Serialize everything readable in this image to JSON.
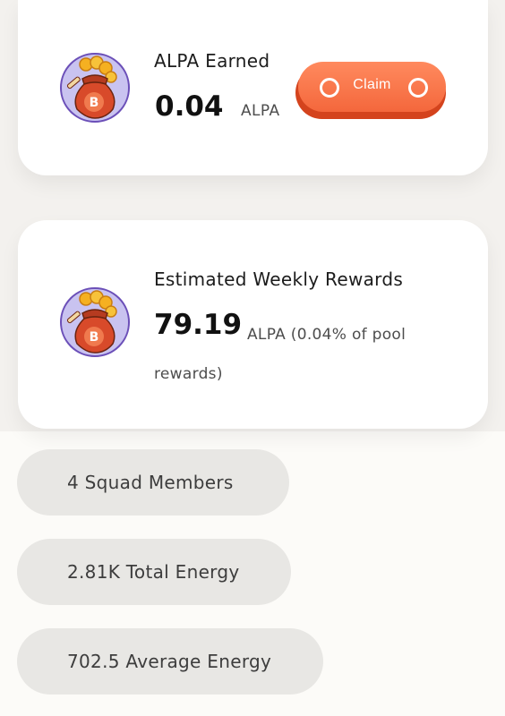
{
  "colors": {
    "accent": "#f4673c",
    "bag_fill": "#d84a2a",
    "coin": "#f5b021",
    "background_top": "#f3f1ee",
    "background_bottom": "#fcfbf8",
    "pill": "#e8e7e4"
  },
  "earned": {
    "label": "ALPA Earned",
    "amount": "0.04",
    "unit": "ALPA",
    "icon": "bitcoin-coin-bag-icon",
    "claim_label": "Claim"
  },
  "weekly": {
    "label": "Estimated Weekly Rewards",
    "amount": "79.19",
    "note": "ALPA  (0.04% of pool rewards)",
    "icon": "bitcoin-coin-bag-icon"
  },
  "stats": [
    {
      "label": "4 Squad Members"
    },
    {
      "label": "2.81K Total Energy"
    },
    {
      "label": "702.5 Average Energy"
    }
  ]
}
